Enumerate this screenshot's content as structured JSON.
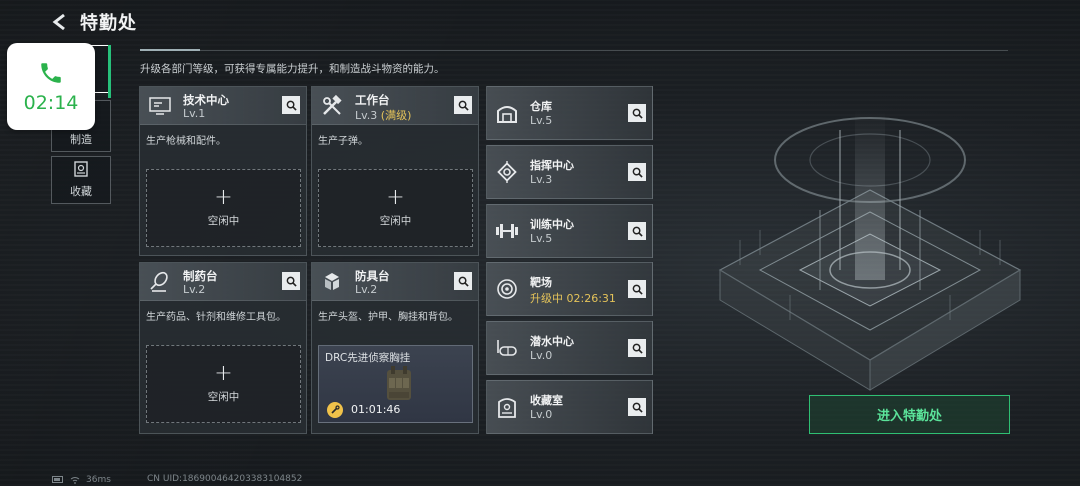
{
  "header": {
    "title": "特勤处",
    "subtitle": "升级各部门等级，可获得专属能力提升，和制造战斗物资的能力。"
  },
  "call": {
    "time": "02:14"
  },
  "tabs": [
    {
      "label": "制造",
      "icon": "factory-icon"
    },
    {
      "label": "收藏",
      "icon": "collection-icon"
    }
  ],
  "workshops": [
    {
      "name": "技术中心",
      "level": "Lv.1",
      "level_extra": "",
      "desc": "生产枪械和配件。",
      "slot": "空闲中",
      "icon": "tech-center-icon"
    },
    {
      "name": "工作台",
      "level": "Lv.3",
      "level_extra": "(满级)",
      "desc": "生产子弹。",
      "slot": "空闲中",
      "icon": "workbench-icon"
    },
    {
      "name": "制药台",
      "level": "Lv.2",
      "level_extra": "",
      "desc": "生产药品、针剂和维修工具包。",
      "slot": "空闲中",
      "icon": "pharmacy-icon"
    },
    {
      "name": "防具台",
      "level": "Lv.2",
      "level_extra": "",
      "desc": "生产头盔、护甲、胸挂和背包。",
      "icon": "armor-bench-icon",
      "crafting": {
        "item": "DRC先进侦察胸挂",
        "timer": "01:01:46"
      }
    }
  ],
  "facilities": [
    {
      "name": "仓库",
      "level": "Lv.5",
      "upgrading": false,
      "icon": "warehouse-icon"
    },
    {
      "name": "指挥中心",
      "level": "Lv.3",
      "upgrading": false,
      "icon": "command-center-icon"
    },
    {
      "name": "训练中心",
      "level": "Lv.5",
      "upgrading": false,
      "icon": "dumbbell-icon"
    },
    {
      "name": "靶场",
      "level": "升级中 02:26:31",
      "upgrading": true,
      "icon": "target-icon"
    },
    {
      "name": "潜水中心",
      "level": "Lv.0",
      "upgrading": false,
      "icon": "diving-mask-icon"
    },
    {
      "name": "收藏室",
      "level": "Lv.0",
      "upgrading": false,
      "icon": "collection-room-icon"
    }
  ],
  "enter_button": "进入特勤处",
  "footer": {
    "ping": "36ms",
    "uid": "CN UID:18690046420338310485​2"
  },
  "colors": {
    "accent_green": "#2fbf73",
    "upgrade_gold": "#e4c35a",
    "call_green": "#2bb24c"
  }
}
